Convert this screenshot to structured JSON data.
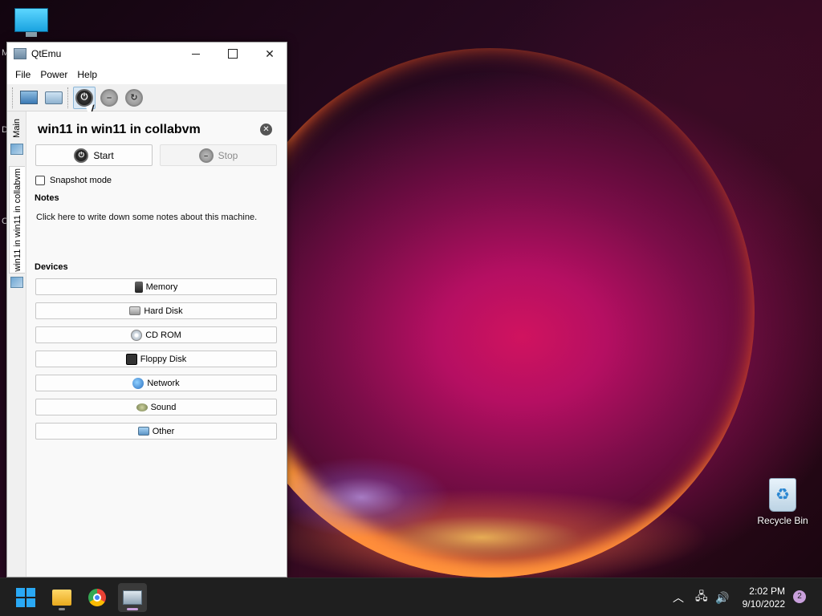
{
  "window": {
    "title": "QtEmu",
    "menu": [
      "File",
      "Power",
      "Help"
    ]
  },
  "sidebar": {
    "main_tab": "Main",
    "vm_tab": "win11 in win11 in collabvm"
  },
  "machine": {
    "name": "win11 in win11 in collabvm",
    "start_label": "Start",
    "stop_label": "Stop",
    "snapshot_label": "Snapshot mode",
    "notes_heading": "Notes",
    "notes_text": "Click here to write down some notes about this machine.",
    "devices_heading": "Devices",
    "devices": [
      "Memory",
      "Hard Disk",
      "CD ROM",
      "Floppy Disk",
      "Network",
      "Sound",
      "Other"
    ]
  },
  "desktop": {
    "recycle_bin": "Recycle Bin"
  },
  "taskbar": {
    "time": "2:02 PM",
    "date": "9/10/2022",
    "notification_count": "2",
    "accent": "#2aa9f5"
  },
  "icons": [
    "start-icon",
    "file-explorer-icon",
    "chrome-icon",
    "qtemu-icon",
    "chevron-up-icon",
    "network-icon",
    "volume-icon"
  ]
}
